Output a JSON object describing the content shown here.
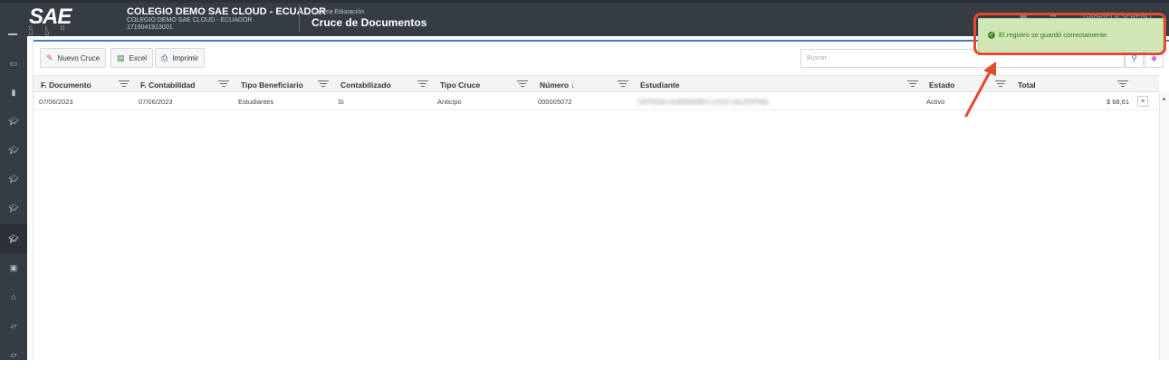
{
  "header": {
    "logo": "SAE",
    "logo_sub": "C L O U D",
    "company_name": "COLEGIO DEMO SAE CLOUD - ECUADOR",
    "company_sub": "COLEGIO DEMO SAE CLOUD - ECUADOR",
    "company_id": "1719041913001",
    "module_section": "Cartera Educación",
    "module_title": "Cruce de Documentos",
    "user_name": "GABRIELA SERENO"
  },
  "toast": {
    "message": "El registro se guardó correctamente",
    "color": "#cfe7b5"
  },
  "toolbar": {
    "new_label": "Nuevo Cruce",
    "excel_label": "Excel",
    "print_label": "Imprimir",
    "search_placeholder": "Buscar"
  },
  "table": {
    "columns": [
      "F. Documento",
      "F. Contabilidad",
      "Tipo Beneficiario",
      "Contabilizado",
      "Tipo Cruce",
      "Número ↓",
      "Estudiante",
      "Estado",
      "Total"
    ],
    "rows": [
      {
        "f_documento": "07/06/2023",
        "f_contabilidad": "07/06/2023",
        "tipo_beneficiario": "Estudiantes",
        "contabilizado": "Si",
        "tipo_cruce": "Anticipo",
        "numero": "000005072",
        "estudiante": "ORTEGA GUERRERO LUCIA VALENTINA",
        "estado": "Activo",
        "total": "$ 68,61"
      }
    ]
  },
  "colors": {
    "header": "#353c44",
    "accent": "#3a7fc4",
    "annotation": "#e24a32"
  }
}
